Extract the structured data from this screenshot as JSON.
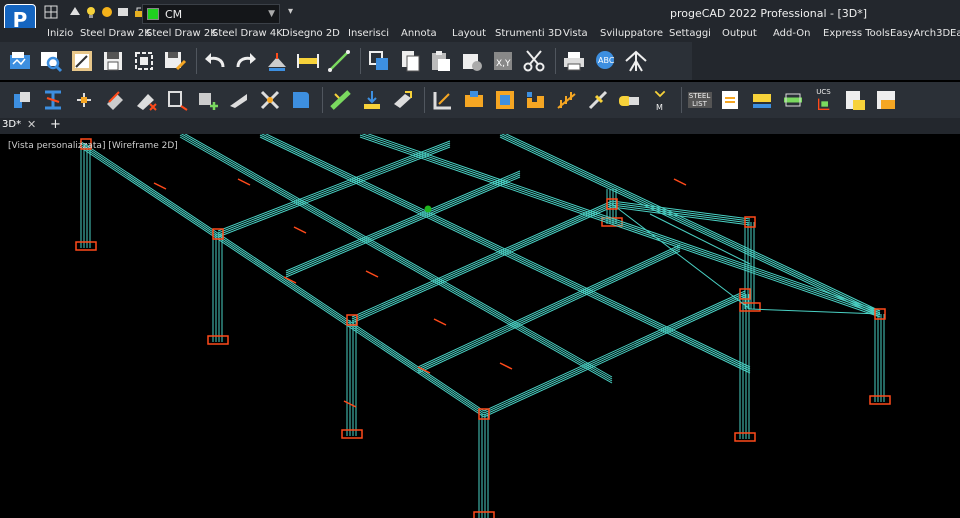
{
  "app": {
    "title": "progeCAD 2022 Professional - [3D*]",
    "logo_letter": "P"
  },
  "quick_access": {
    "layer_name": "CM",
    "layer_color": "#1fd11f",
    "more": "▾"
  },
  "menu": {
    "items": [
      "Inizio",
      "Steel Draw 2K",
      "Steel Draw 2K",
      "Steel Draw 4K",
      "Disegno 2D",
      "Inserisci",
      "Annota",
      "Layout",
      "Strumenti 3D",
      "Vista",
      "Sviluppatore",
      "Settaggi",
      "Output",
      "Add-On",
      "Express Tools",
      "EasyArch3D",
      "Ea"
    ]
  },
  "toolbar_row1": {
    "icons": [
      "open-drawing-icon",
      "find-file-icon",
      "plot-preview-icon",
      "save-icon",
      "zoom-extents-icon",
      "save-as-icon",
      "undo-icon",
      "redo-icon",
      "measure-area-icon",
      "dimension-icon",
      "line-icon",
      "copy-objects-icon",
      "paste-icon",
      "paste-special-icon",
      "print-settings-icon",
      "xy-coordinates-icon",
      "cut-icon",
      "print-icon",
      "spell-check-icon",
      "network-icon"
    ]
  },
  "toolbar_row2": {
    "icons": [
      "steel-column-icon",
      "steel-beam-icon",
      "steel-section-icon",
      "steel-plate-icon",
      "steel-bracing-icon",
      "steel-connection-icon",
      "steel-add-icon",
      "steel-angle-icon",
      "steel-cut-icon",
      "steel-bent-plate-icon",
      "steel-weld-icon",
      "steel-anchor-icon",
      "steel-stiffener-icon",
      "steel-profile-icon",
      "steel-joint-icon",
      "steel-stair-icon",
      "steel-grating-icon",
      "steel-railing-icon",
      "steel-bolt-icon",
      "steel-marking-icon",
      "steel-list-icon",
      "steel-export-icon",
      "steel-truss-icon",
      "steel-piping-icon",
      "ucs-icon",
      "steel-report-icon",
      "steel-sheet-icon"
    ],
    "steel_list_text": "STEEL LIST",
    "ucs_text": "UCS",
    "marking_text": "M"
  },
  "tabs": {
    "active": "3D*",
    "close": "✕",
    "add": "+"
  },
  "viewport": {
    "label": "[Vista personalizzata] [Wireframe 2D]",
    "wire_color": "#4ad1c4",
    "accent_color": "#ff4a1a"
  }
}
